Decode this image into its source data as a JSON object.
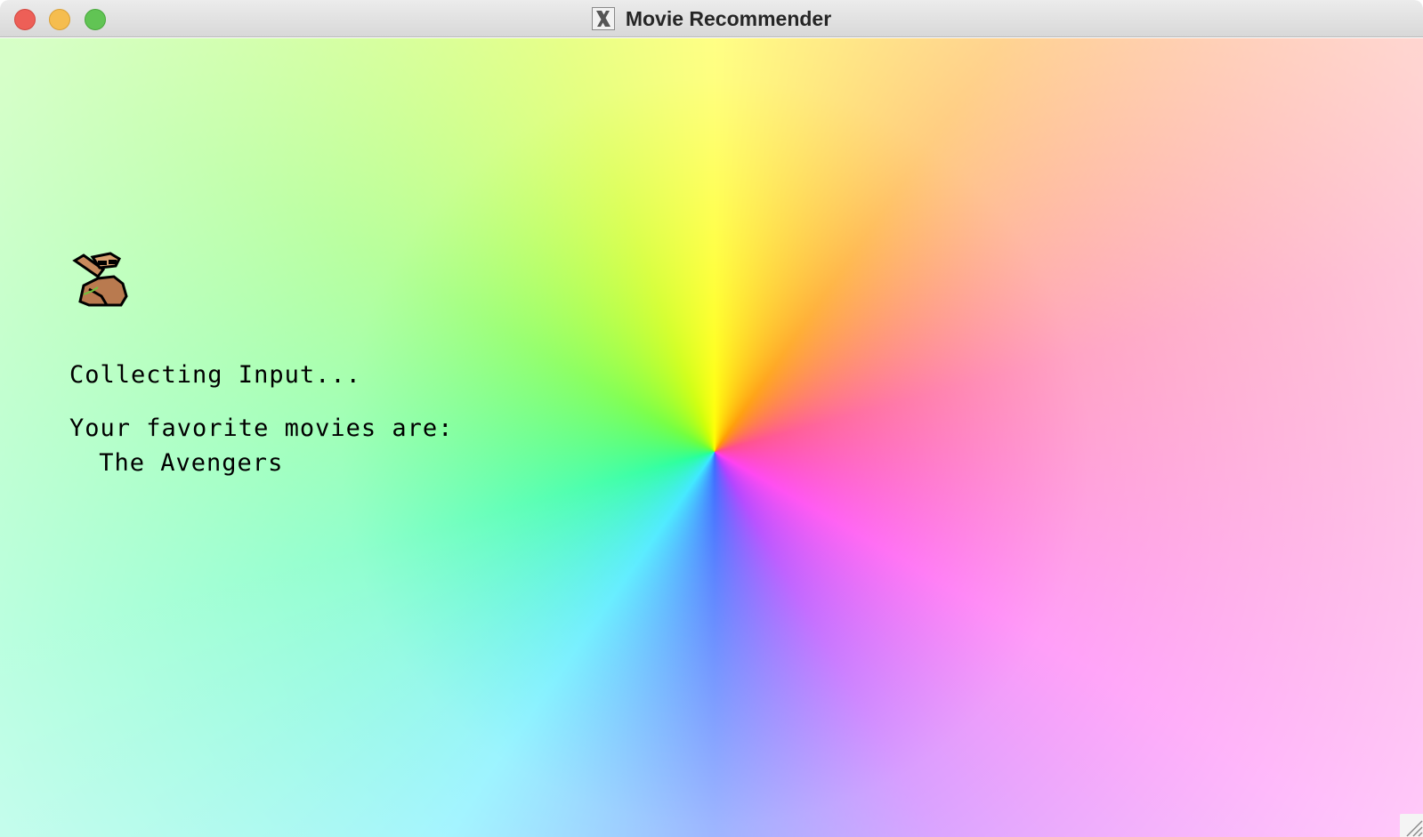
{
  "window": {
    "title": "Movie Recommender"
  },
  "content": {
    "status": "Collecting Input...",
    "favorites_label": "Your favorite movies are:",
    "favorites": [
      " The Avengers"
    ]
  },
  "colors": {
    "titlebar_bg": "#e3e3e3",
    "close": "#ed5f57",
    "minimize": "#f5bd4f",
    "maximize": "#61c454",
    "text": "#000000"
  },
  "icons": {
    "app_icon": "x11-icon",
    "mascot": "camel-mascot-icon",
    "resize": "resize-grip-icon"
  }
}
